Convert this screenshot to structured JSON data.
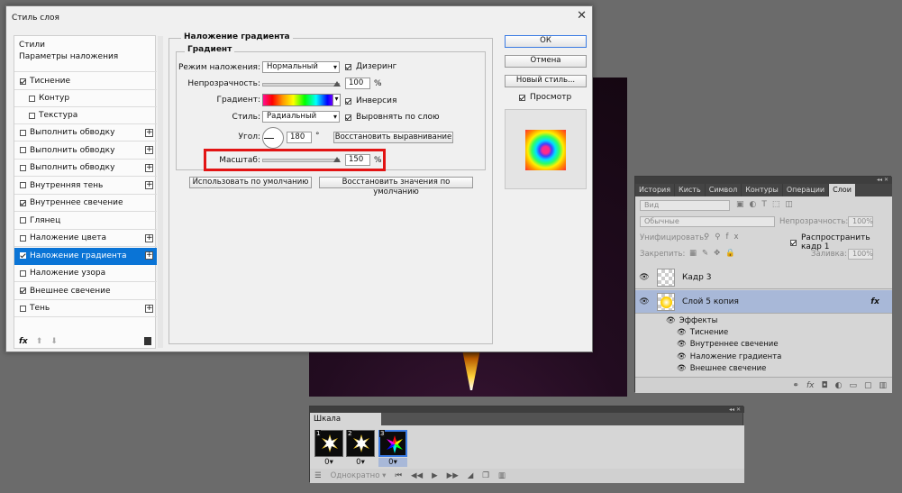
{
  "dialog": {
    "title": "Стиль слоя",
    "close": "✕",
    "styles_header": "Стили",
    "blend_options": "Параметры наложения",
    "items": [
      {
        "label": "Тиснение",
        "checked": true,
        "plus": false,
        "indent": false
      },
      {
        "label": "Контур",
        "checked": false,
        "plus": false,
        "indent": true
      },
      {
        "label": "Текстура",
        "checked": false,
        "plus": false,
        "indent": true
      },
      {
        "label": "Выполнить обводку",
        "checked": false,
        "plus": true
      },
      {
        "label": "Выполнить обводку",
        "checked": false,
        "plus": true
      },
      {
        "label": "Выполнить обводку",
        "checked": false,
        "plus": true
      },
      {
        "label": "Внутренняя тень",
        "checked": false,
        "plus": true
      },
      {
        "label": "Внутреннее свечение",
        "checked": true,
        "plus": false
      },
      {
        "label": "Глянец",
        "checked": false,
        "plus": false
      },
      {
        "label": "Наложение цвета",
        "checked": false,
        "plus": true
      },
      {
        "label": "Наложение градиента",
        "checked": true,
        "plus": true,
        "selected": true
      },
      {
        "label": "Наложение узора",
        "checked": false,
        "plus": false
      },
      {
        "label": "Внешнее свечение",
        "checked": true,
        "plus": false
      },
      {
        "label": "Тень",
        "checked": false,
        "plus": true
      }
    ],
    "footer": {
      "fx": "fx",
      "up": "⬆",
      "down": "⬇",
      "trash": "🗑"
    },
    "section_title": "Наложение градиента",
    "subsection_title": "Градиент",
    "blend_mode_label": "Режим наложения:",
    "blend_mode_value": "Нормальный",
    "dither_label": "Дизеринг",
    "opacity_label": "Непрозрачность:",
    "opacity_value": "100",
    "percent": "%",
    "gradient_label": "Градиент:",
    "reverse_label": "Инверсия",
    "style_label": "Стиль:",
    "style_value": "Радиальный",
    "align_label": "Выровнять по слою",
    "angle_label": "Угол:",
    "angle_value": "180",
    "degree": "°",
    "reset_align": "Восстановить выравнивание",
    "scale_label": "Масштаб:",
    "scale_value": "150",
    "make_default": "Использовать по умолчанию",
    "reset_default": "Восстановить значения по умолчанию",
    "ok": "ОК",
    "cancel": "Отмена",
    "new_style": "Новый стиль...",
    "preview_label": "Просмотр"
  },
  "layers_panel": {
    "tabs": [
      "История",
      "Кисть",
      "Символ",
      "Контуры",
      "Операции",
      "Слои"
    ],
    "active_tab": "Слои",
    "filter_placeholder": "Вид",
    "blend_mode": "Обычные",
    "opacity_label": "Непрозрачность:",
    "opacity_value": "100%",
    "unify_label": "Унифицировать:",
    "propagate_label": "Распространить кадр 1",
    "lock_label": "Закрепить:",
    "fill_label": "Заливка:",
    "fill_value": "100%",
    "layers": [
      {
        "name": "Кадр 3",
        "selected": false
      },
      {
        "name": "Слой 5 копия",
        "selected": true,
        "fx": "fx"
      }
    ],
    "effects_label": "Эффекты",
    "effects": [
      "Тиснение",
      "Внутреннее свечение",
      "Наложение градиента",
      "Внешнее свечение"
    ]
  },
  "timeline": {
    "title": "Шкала времени",
    "frames": [
      {
        "num": "1",
        "delay": "0"
      },
      {
        "num": "2",
        "delay": "0"
      },
      {
        "num": "3",
        "delay": "0"
      }
    ],
    "loop": "Однократно"
  },
  "colors": {
    "selection": "#0a74d6",
    "highlight_box": "#e21414",
    "layer_selected": "#a8b8d8"
  }
}
